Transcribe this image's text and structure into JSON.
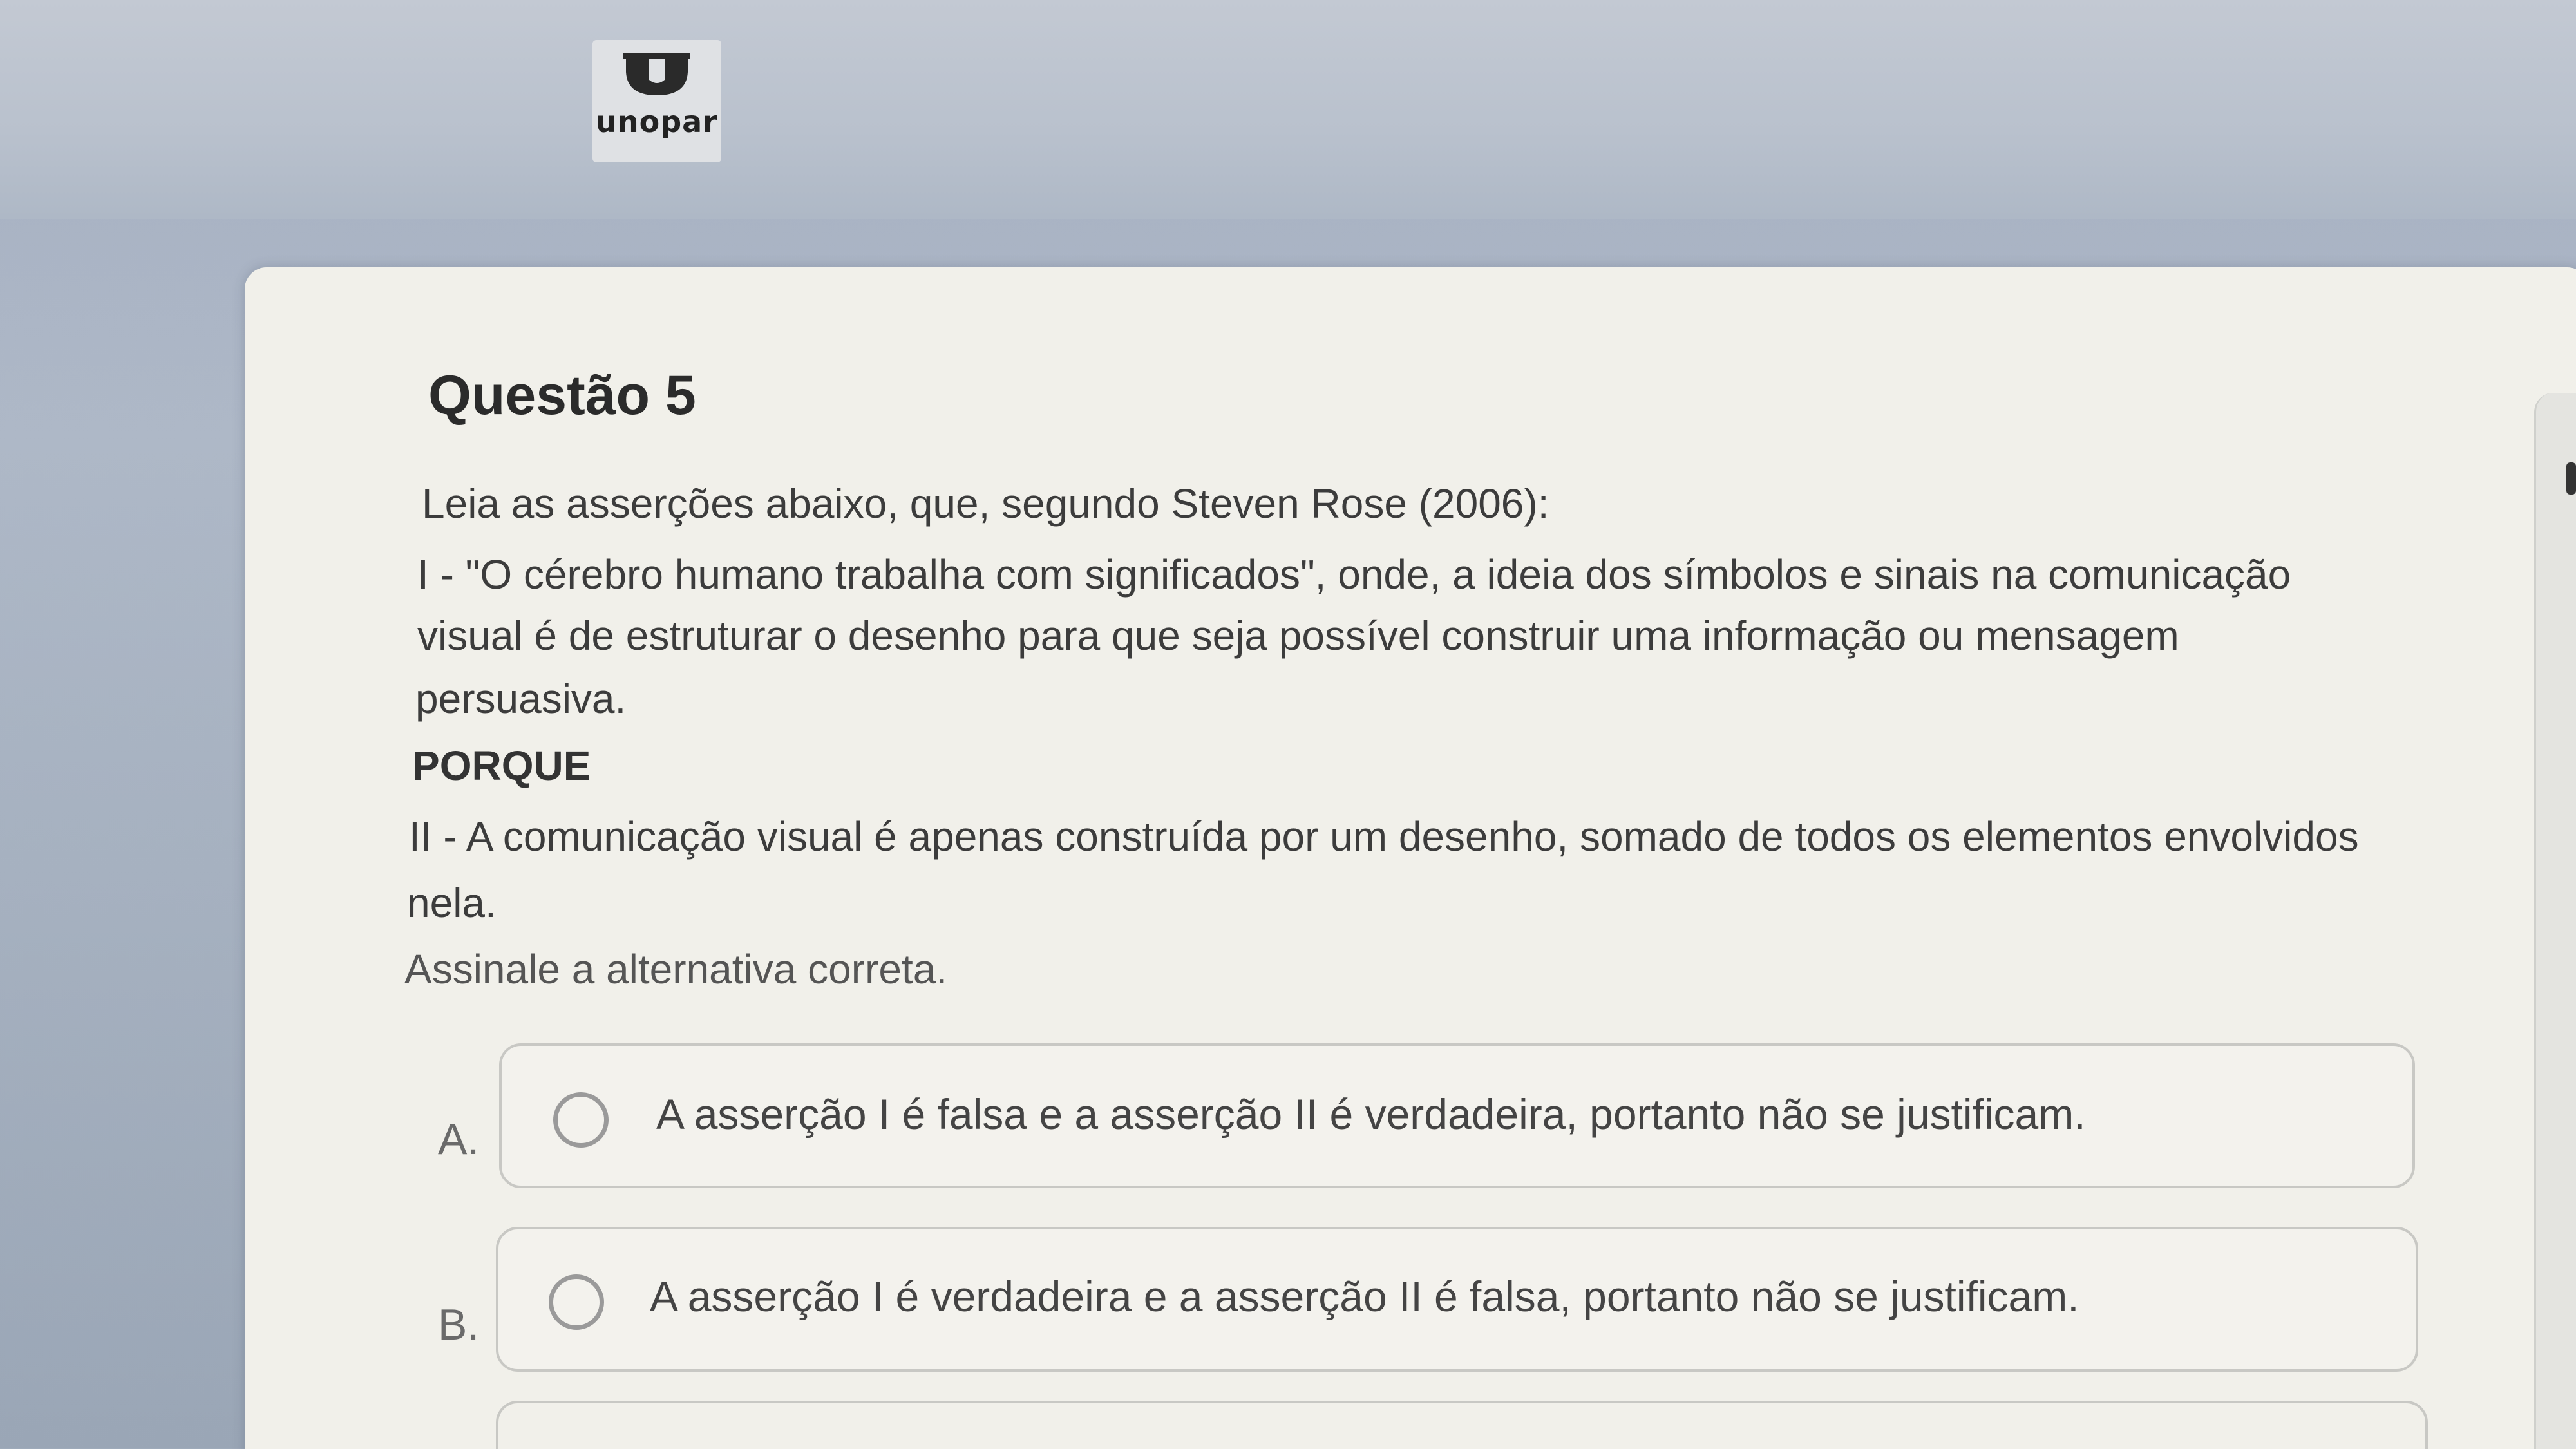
{
  "brand": {
    "logo_text": "unopar"
  },
  "question": {
    "title": "Questão 5",
    "lines": [
      "Leia as asserções abaixo, que, segundo Steven Rose (2006):",
      "I - \"O cérebro humano trabalha com significados\", onde, a ideia dos símbolos e sinais na comunicação",
      "visual é de estruturar o desenho para que seja possível construir uma informação ou mensagem",
      "persuasiva.",
      "PORQUE",
      "II - A comunicação visual é apenas construída por um desenho, somado de todos os elementos envolvidos",
      "nela.",
      "Assinale a alternativa correta."
    ]
  },
  "options": [
    {
      "letter": "A.",
      "text": "A asserção I é falsa e a asserção II é verdadeira, portanto não se justificam."
    },
    {
      "letter": "B.",
      "text": "A asserção I é verdadeira e a asserção II é falsa, portanto não se justificam."
    }
  ]
}
